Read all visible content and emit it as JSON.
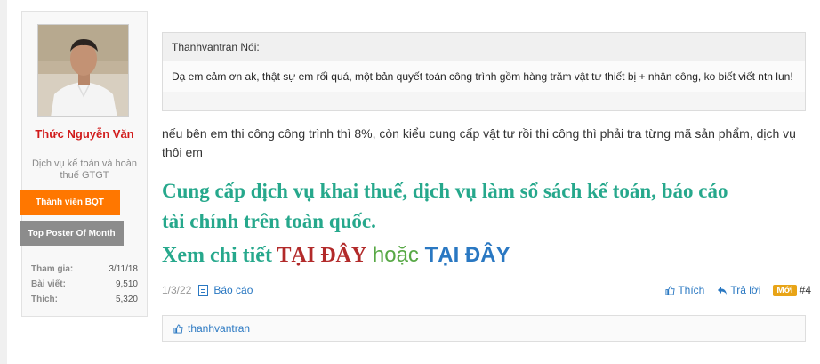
{
  "user": {
    "name": "Thức Nguyễn Văn",
    "title": "Dịch vụ kế toán và hoàn thuế GTGT",
    "banners": [
      "Thành viên BQT",
      "Top Poster Of Month"
    ],
    "stats": [
      {
        "label": "Tham gia:",
        "value": "3/11/18"
      },
      {
        "label": "Bài viết:",
        "value": "9,510"
      },
      {
        "label": "Thích:",
        "value": "5,320"
      }
    ]
  },
  "quote": {
    "author": "Thanhvantran Nói:",
    "text": "Dạ em cảm ơn ak, thật sự em rối quá, một bản quyết toán công trình gồm hàng trăm vật tư thiết bị + nhân công, ko biết viết ntn lun!"
  },
  "message": "nếu bên em thi công công trình thì 8%, còn kiểu cung cấp vật tư rồi thi công thì phải tra từng mã sản phẩm, dịch vụ thôi em",
  "signature": {
    "line1": "Cung cấp dịch vụ khai thuế, dịch vụ làm sổ sách kế toán, báo cáo",
    "line2": "tài chính trên toàn quốc.",
    "lead": "Xem chi tiết ",
    "link1": "TẠI ĐÂY",
    "or": " hoặc ",
    "link2": "TẠI ĐÂY"
  },
  "meta": {
    "date": "1/3/22",
    "report": "Báo cáo",
    "like": "Thích",
    "reply": "Trả lời",
    "new_badge": "Mới",
    "post_number": "#4"
  },
  "likes": {
    "users": "thanhvantran"
  },
  "colors": {
    "username": "#d11b1b",
    "banner_orange": "#ff7700",
    "banner_gray": "#8c8c8c",
    "signature": "#26a88c",
    "link": "#2a78c2"
  }
}
